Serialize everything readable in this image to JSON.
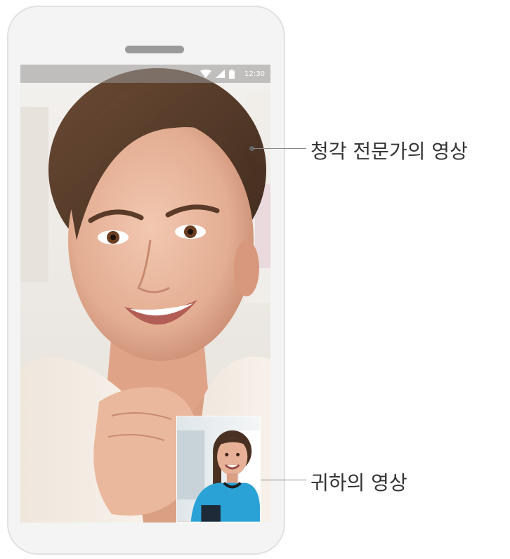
{
  "status_bar": {
    "time": "12:30",
    "icons": [
      "wifi-icon",
      "signal-icon",
      "battery-icon"
    ]
  },
  "main_video": {
    "icon": "video-person-icon"
  },
  "self_video": {
    "icon": "self-view-person-icon"
  },
  "callouts": {
    "specialist_video": "청각 전문가의 영상",
    "your_video": "귀하의 영상"
  },
  "colors": {
    "status_bar": "#969696",
    "callout_line": "#888888",
    "callout_text": "#333333",
    "shirt": "#2aa2d6"
  }
}
